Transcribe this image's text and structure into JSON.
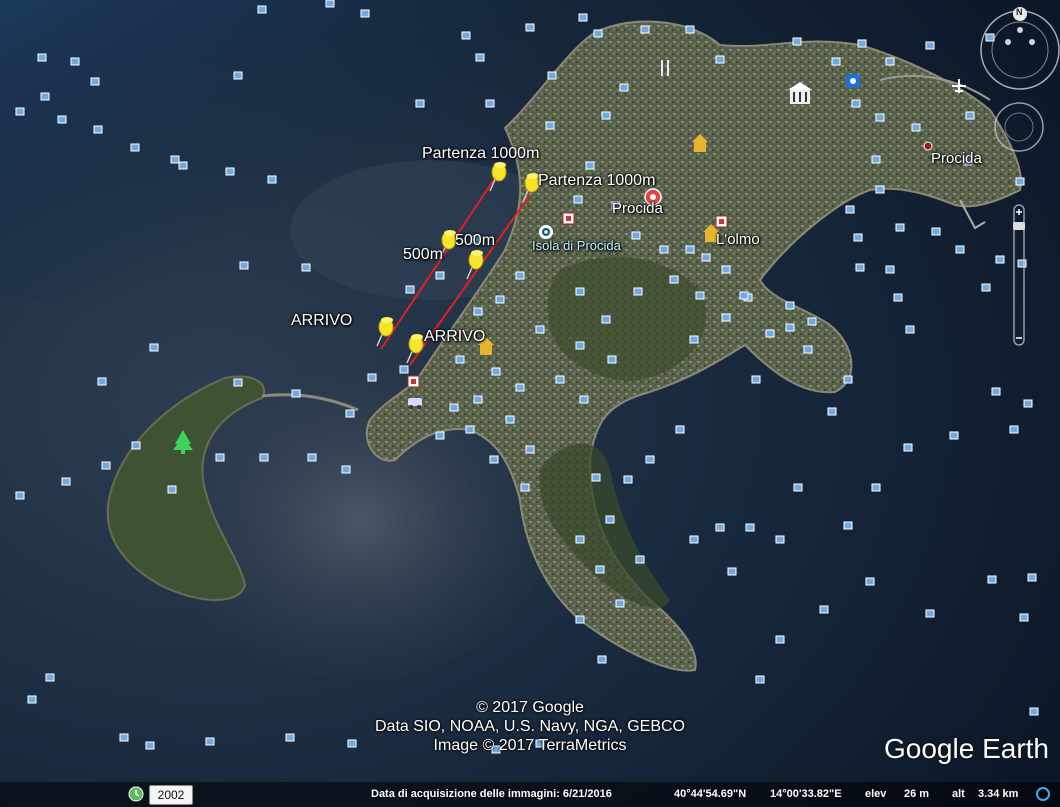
{
  "placemarks": {
    "start_1": "Partenza 1000m",
    "start_2": "Partenza 1000m",
    "mid_1": "500m",
    "mid_2": "500m",
    "finish_1": "ARRIVO",
    "finish_2": "ARRIVO"
  },
  "places": {
    "procida_center": "Procida",
    "procida_port": "Procida",
    "lolmo": "L'olmo",
    "isola": "Isola di Procida"
  },
  "copyright": {
    "line1": "© 2017 Google",
    "line2": "Data SIO, NOAA, U.S. Navy, NGA, GEBCO",
    "line3": "Image © 2017 TerraMetrics"
  },
  "brand": "Google Earth",
  "status": {
    "year": "2002",
    "acquisition": "Data di acquisizione delle immagini: 6/21/2016",
    "lat": "40°44'54.69\"N",
    "lon": "14°00'33.82\"E",
    "elev_label": "elev",
    "elev_value": "26 m",
    "alt_label": "alt",
    "alt_value": "3.34 km"
  },
  "navigation": {
    "north_label": "N"
  },
  "colors": {
    "sea_deep": "#0f2035",
    "sea_shallow": "#3a4a5a",
    "land": "#4a5a3a",
    "route_line": "#e02020",
    "pin": "#f5e62a"
  }
}
